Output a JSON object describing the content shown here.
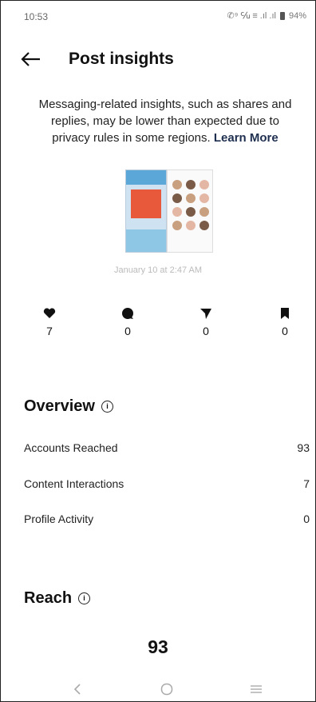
{
  "status_bar": {
    "time": "10:53",
    "indicators": "✆⁹ ℆ ≡ .ıl .ıl",
    "battery": "94%"
  },
  "header": {
    "title": "Post insights",
    "back_icon": "arrow-left-icon"
  },
  "notice": {
    "text": "Messaging-related insights, such as shares and replies, may be lower than expected due to privacy rules in some regions.",
    "link": "Learn More"
  },
  "post": {
    "date": "January 10 at 2:47 AM"
  },
  "stats": [
    {
      "icon": "heart-icon",
      "value": "7"
    },
    {
      "icon": "comment-icon",
      "value": "0"
    },
    {
      "icon": "share-icon",
      "value": "0"
    },
    {
      "icon": "bookmark-icon",
      "value": "0"
    }
  ],
  "overview": {
    "title": "Overview",
    "rows": [
      {
        "label": "Accounts Reached",
        "value": "93"
      },
      {
        "label": "Content Interactions",
        "value": "7"
      },
      {
        "label": "Profile Activity",
        "value": "0"
      }
    ]
  },
  "reach": {
    "title": "Reach",
    "value": "93"
  },
  "nav": [
    "back-nav-icon",
    "home-nav-icon",
    "recents-nav-icon"
  ]
}
